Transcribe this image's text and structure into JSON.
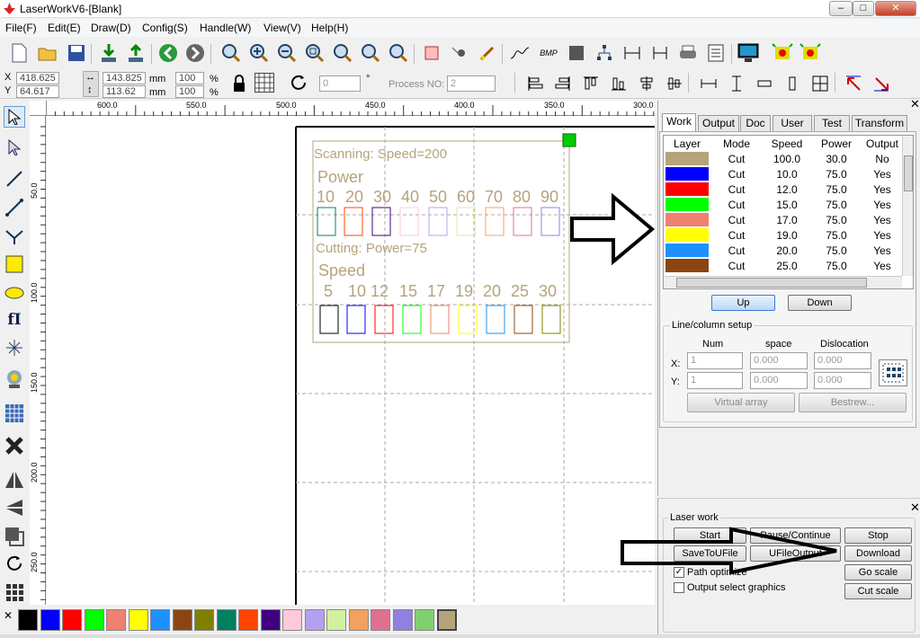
{
  "window": {
    "title": "LaserWorkV6-[Blank]"
  },
  "menu": [
    "File(F)",
    "Edit(E)",
    "Draw(D)",
    "Config(S)",
    "Handle(W)",
    "View(V)",
    "Help(H)"
  ],
  "props": {
    "x_label": "X",
    "y_label": "Y",
    "x": "418.625",
    "y": "64.617",
    "w": "143.825",
    "h": "113.62",
    "mm": "mm",
    "sx": "100",
    "sy": "100",
    "pct": "%",
    "rot": "0",
    "deg": "°",
    "proc_label": "Process NO:",
    "proc": "2"
  },
  "ruler": {
    "top": [
      "600.0",
      "550.0",
      "500.0",
      "450.0",
      "400.0",
      "350.0",
      "300.0"
    ],
    "left": [
      "50.0",
      "100.0",
      "150.0",
      "200.0",
      "250.0"
    ]
  },
  "canvas": {
    "scan_title": "Scanning: Speed=200",
    "power_label": "Power",
    "power_nums": [
      "10",
      "20",
      "30",
      "40",
      "50",
      "60",
      "70",
      "80",
      "90"
    ],
    "cut_title": "Cutting: Power=75",
    "speed_label": "Speed",
    "speed_nums": [
      "5",
      "10",
      "12",
      "15",
      "17",
      "19",
      "20",
      "25",
      "30"
    ]
  },
  "tabs": [
    "Work",
    "Output",
    "Doc",
    "User",
    "Test",
    "Transform"
  ],
  "layer_table": {
    "headers": [
      "Layer",
      "Mode",
      "Speed",
      "Power",
      "Output"
    ],
    "rows": [
      {
        "color": "#b5a47a",
        "mode": "Cut",
        "speed": "100.0",
        "power": "30.0",
        "out": "No"
      },
      {
        "color": "#0000ff",
        "mode": "Cut",
        "speed": "10.0",
        "power": "75.0",
        "out": "Yes"
      },
      {
        "color": "#ff0000",
        "mode": "Cut",
        "speed": "12.0",
        "power": "75.0",
        "out": "Yes"
      },
      {
        "color": "#00ff00",
        "mode": "Cut",
        "speed": "15.0",
        "power": "75.0",
        "out": "Yes"
      },
      {
        "color": "#f08070",
        "mode": "Cut",
        "speed": "17.0",
        "power": "75.0",
        "out": "Yes"
      },
      {
        "color": "#ffff00",
        "mode": "Cut",
        "speed": "19.0",
        "power": "75.0",
        "out": "Yes"
      },
      {
        "color": "#1e90ff",
        "mode": "Cut",
        "speed": "20.0",
        "power": "75.0",
        "out": "Yes"
      },
      {
        "color": "#8b4513",
        "mode": "Cut",
        "speed": "25.0",
        "power": "75.0",
        "out": "Yes"
      }
    ]
  },
  "buttons": {
    "up": "Up",
    "down": "Down",
    "virtual": "Virtual array",
    "bestrew": "Bestrew...",
    "start": "Start",
    "pause": "Pause/Continue",
    "stop": "Stop",
    "save": "SaveToUFile",
    "ufile": "UFileOutput",
    "download": "Download",
    "goscale": "Go scale",
    "cutscale": "Cut scale"
  },
  "linecol": {
    "title": "Line/column setup",
    "num": "Num",
    "space": "space",
    "disl": "Dislocation",
    "x": "X:",
    "y": "Y:",
    "xn": "1",
    "yn": "1",
    "xs": "0.000",
    "ys": "0.000",
    "xd": "0.000",
    "yd": "0.000"
  },
  "laser": {
    "title": "Laser work",
    "path": "Path optimize",
    "outsel": "Output select graphics"
  },
  "palette": [
    "#000000",
    "#0000ff",
    "#ff0000",
    "#00ff00",
    "#f08070",
    "#ffff00",
    "#1e90ff",
    "#8b4513",
    "#808000",
    "#008060",
    "#ff4500",
    "#400080",
    "#ffc8dc",
    "#b4a0f0",
    "#d2f0a0",
    "#f4a060",
    "#e07090",
    "#9080e0",
    "#80d070",
    "#b5a47a"
  ],
  "colors": {
    "accent": "#3a7bd5",
    "sel": "#00cc00"
  }
}
